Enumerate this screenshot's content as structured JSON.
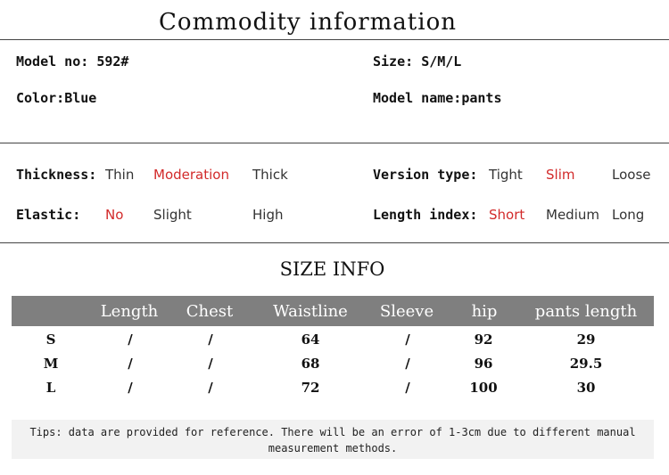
{
  "header": {
    "title": "Commodity information"
  },
  "basic": {
    "model_no_label": "Model no:",
    "model_no_value": "592#",
    "size_label": "Size:",
    "size_value": "S/M/L",
    "color_label": "Color:",
    "color_value": "Blue",
    "model_name_label": "Model name:",
    "model_name_value": "pants"
  },
  "attributes": {
    "thickness": {
      "label": "Thickness:",
      "options": [
        "Thin",
        "Moderation",
        "Thick"
      ],
      "selected": "Moderation"
    },
    "version_type": {
      "label": "Version type:",
      "options": [
        "Tight",
        "Slim",
        "Loose"
      ],
      "selected": "Slim"
    },
    "elastic": {
      "label": "Elastic:",
      "options": [
        "No",
        "Slight",
        "High"
      ],
      "selected": "No"
    },
    "length_index": {
      "label": "Length index:",
      "options": [
        "Short",
        "Medium",
        "Long"
      ],
      "selected": "Short"
    }
  },
  "size_info": {
    "title": "SIZE INFO",
    "headers": [
      "",
      "Length",
      "Chest",
      "Waistline",
      "Sleeve",
      "hip",
      "pants length"
    ],
    "rows": [
      [
        "S",
        "/",
        "/",
        "64",
        "/",
        "92",
        "29"
      ],
      [
        "M",
        "/",
        "/",
        "68",
        "/",
        "96",
        "29.5"
      ],
      [
        "L",
        "/",
        "/",
        "72",
        "/",
        "100",
        "30"
      ]
    ]
  },
  "tips": "Tips: data are provided for reference. There will be an error of 1-3cm due to different manual measurement methods.",
  "colors": {
    "selected": "#d22a2a",
    "table_header_bg": "#7f7f7f",
    "tips_bg": "#f2f2f2"
  }
}
